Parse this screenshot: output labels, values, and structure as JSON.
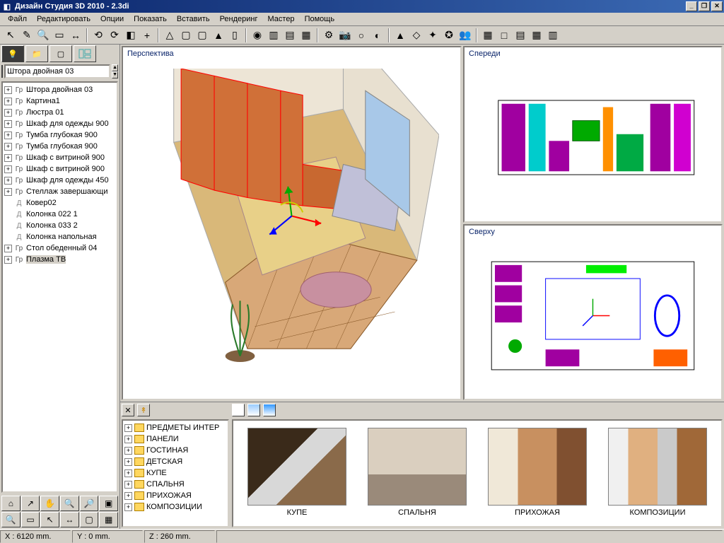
{
  "title": "Дизайн Студия 3D 2010 - 2.3di",
  "menu": [
    "Файл",
    "Редактировать",
    "Опции",
    "Показать",
    "Вставить",
    "Рендеринг",
    "Мастер",
    "Помощь"
  ],
  "selected_object": "Штора двойная 03",
  "scene_tree": [
    {
      "plus": true,
      "kind": "Гр",
      "label": "Штора двойная 03"
    },
    {
      "plus": true,
      "kind": "Гр",
      "label": "Картина1"
    },
    {
      "plus": true,
      "kind": "Гр",
      "label": "Люстра 01"
    },
    {
      "plus": true,
      "kind": "Гр",
      "label": "Шкаф для одежды 900"
    },
    {
      "plus": true,
      "kind": "Гр",
      "label": "Тумба глубокая 900"
    },
    {
      "plus": true,
      "kind": "Гр",
      "label": "Тумба глубокая 900"
    },
    {
      "plus": true,
      "kind": "Гр",
      "label": "Шкаф с витриной 900"
    },
    {
      "plus": true,
      "kind": "Гр",
      "label": "Шкаф с витриной 900"
    },
    {
      "plus": true,
      "kind": "Гр",
      "label": "Шкаф для одежды 450"
    },
    {
      "plus": true,
      "kind": "Гр",
      "label": "Стеллаж завершающи"
    },
    {
      "plus": false,
      "kind": "Д",
      "label": "Ковер02"
    },
    {
      "plus": false,
      "kind": "Д",
      "label": "Колонка 022 1"
    },
    {
      "plus": false,
      "kind": "Д",
      "label": "Колонка 033 2"
    },
    {
      "plus": false,
      "kind": "Д",
      "label": "Колонка напольная"
    },
    {
      "plus": true,
      "kind": "Гр",
      "label": "Стол обеденный 04"
    },
    {
      "plus": true,
      "kind": "Гр",
      "label": "Плазма ТВ",
      "selected": true
    }
  ],
  "viewports": {
    "perspective": "Перспектива",
    "front": "Спереди",
    "top": "Сверху"
  },
  "catalog_tree": [
    "ПРЕДМЕТЫ ИНТЕР",
    "ПАНЕЛИ",
    "ГОСТИНАЯ",
    "ДЕТСКАЯ",
    "КУПЕ",
    "СПАЛЬНЯ",
    "ПРИХОЖАЯ",
    "КОМПОЗИЦИИ"
  ],
  "thumbs": [
    {
      "label": "КУПЕ",
      "cls": "furn1"
    },
    {
      "label": "СПАЛЬНЯ",
      "cls": "furn2"
    },
    {
      "label": "ПРИХОЖАЯ",
      "cls": "furn3"
    },
    {
      "label": "КОМПОЗИЦИИ",
      "cls": "furn4"
    }
  ],
  "status": {
    "x": "X : 6120 mm.",
    "y": "Y : 0 mm.",
    "z": "Z : 260 mm."
  },
  "icons": {
    "app": "◧",
    "min": "_",
    "max": "❐",
    "close": "✕",
    "light": "💡",
    "lightbulb": "○",
    "new": "▭",
    "open": "📁",
    "page": "▢",
    "cursor": "↖",
    "edit": "✎",
    "mag": "🔍",
    "rect": "▭",
    "dims": "↔",
    "tool_a": "⟲",
    "tool_b": "⟳",
    "color": "◧",
    "plus": "+",
    "triangle": "△",
    "square": "▢",
    "cone": "▲",
    "col": "▯",
    "cam": "◉",
    "win1": "▥",
    "win2": "▤",
    "win3": "▦",
    "gear": "⚙",
    "photo": "📷",
    "dome": "◐",
    "wand": "✦",
    "drop": "◇",
    "thing": "✪",
    "people": "👥",
    "grid": "▦",
    "mag1": "□",
    "mag2": "▤",
    "mag3": "▦",
    "mag4": "▥",
    "home": "⌂",
    "arrow": "↗",
    "hand": "✋",
    "zoomin": "🔍",
    "zoomout": "🔎",
    "fit": "▣",
    "folder": "📁"
  }
}
